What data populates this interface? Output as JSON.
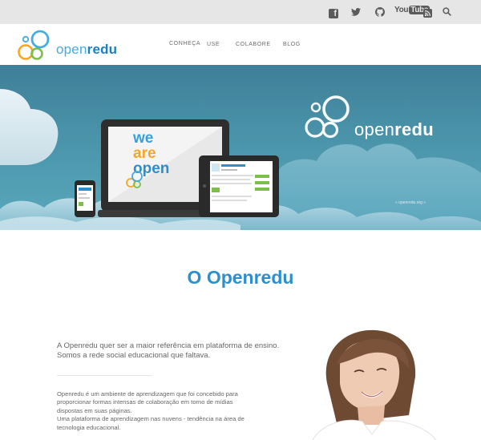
{
  "topbar": {
    "icons": [
      "facebook-icon",
      "twitter-icon",
      "github-icon",
      "youtube-icon",
      "rss-icon",
      "search-icon"
    ],
    "youtube_you": "You",
    "youtube_tube": "Tube"
  },
  "header": {
    "logo_prefix": "open",
    "logo_suffix": "redu",
    "nav": [
      "CONHEÇA",
      "USE",
      "COLABORE",
      "BLOG"
    ]
  },
  "hero": {
    "screen_words": [
      "we",
      "are",
      "open"
    ],
    "logo_prefix": "open",
    "logo_suffix": "redu",
    "logo_caption": "« openredu.org »"
  },
  "main": {
    "title": "O Openredu",
    "intro": "A Openredu quer ser a maior referência em plataforma de ensino. Somos a rede social educacional que faltava.",
    "description_1": "Openredu é um ambiente de aprendizagem que foi concebido para proporcionar formas intensas de colaboração em torno de mídias dispostas em suas páginas.",
    "description_2": "Uma plataforma de aprendizagem nas nuvens - tendência na área de tecnologia educacional."
  },
  "colors": {
    "accent_blue": "#2b8fcf",
    "logo_orange": "#f5a623",
    "logo_green": "#7cc04b",
    "logo_blue": "#43ace0",
    "hero_blue": "#4a94aa",
    "topbar_gray": "#e6e6e6"
  }
}
